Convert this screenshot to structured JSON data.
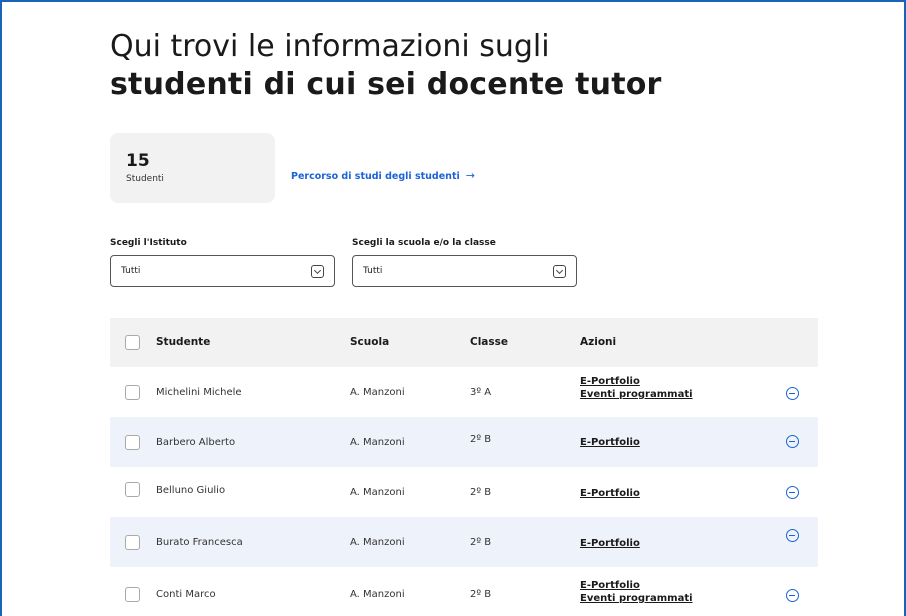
{
  "header": {
    "title_line1": "Qui trovi le informazioni sugli",
    "title_line2": "studenti di cui sei docente tutor"
  },
  "summary": {
    "count": "15",
    "count_label": "Studenti",
    "link_label": "Percorso di studi degli studenti",
    "link_icon": "arrow-right-icon"
  },
  "filters": {
    "institute_label": "Scegli l'Istituto",
    "institute_value": "Tutti",
    "school_label": "Scegli la scuola e/o la classe",
    "school_value": "Tutti"
  },
  "table": {
    "columns": [
      "Studente",
      "Scuola",
      "Classe",
      "Azioni"
    ],
    "rows": [
      {
        "student": "Michelini Michele",
        "school": "A. Manzoni",
        "class": "3º A",
        "actions": [
          "E-Portfolio",
          "Eventi programmati"
        ]
      },
      {
        "student": "Barbero Alberto",
        "school": "A. Manzoni",
        "class": "2º B",
        "actions": [
          "E-Portfolio"
        ]
      },
      {
        "student": "Belluno Giulio",
        "school": "A. Manzoni",
        "class": "2º B",
        "actions": [
          "E-Portfolio"
        ]
      },
      {
        "student": "Burato Francesca",
        "school": "A. Manzoni",
        "class": "2º B",
        "actions": [
          "E-Portfolio"
        ]
      },
      {
        "student": "Conti Marco",
        "school": "A. Manzoni",
        "class": "2º B",
        "actions": [
          "E-Portfolio",
          "Eventi programmati"
        ]
      }
    ]
  },
  "colors": {
    "accent": "#1b63d6",
    "row_highlight": "#eef2fb",
    "header_bg": "#f2f2f3"
  }
}
